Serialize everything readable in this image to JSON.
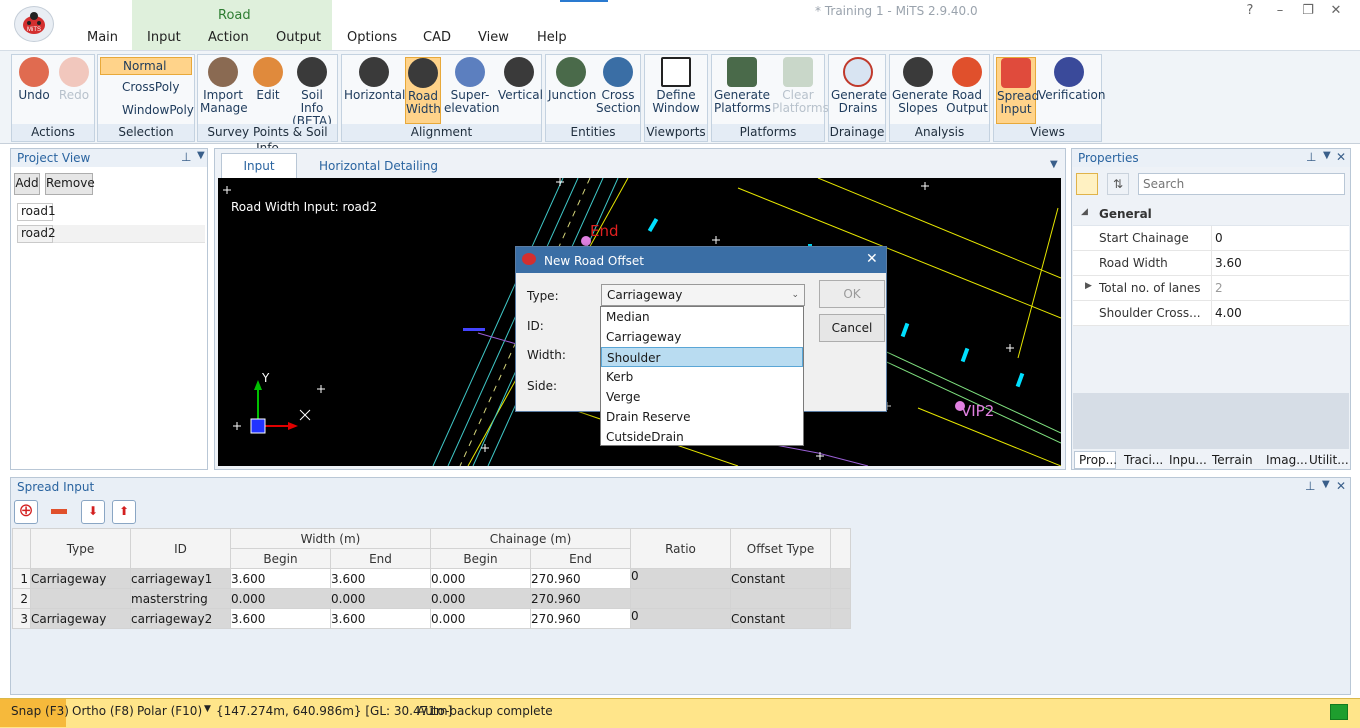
{
  "app": {
    "title": "* Training 1 - MiTS 2.9.40.0",
    "logo_text": "MiTS"
  },
  "window_controls": [
    "?",
    "–",
    "❐",
    "✕"
  ],
  "menu": {
    "tabs": [
      "Main",
      "Input",
      "Action",
      "Output",
      "Options",
      "CAD",
      "View",
      "Help"
    ],
    "road_group_label": "Road"
  },
  "ribbon": {
    "groups": [
      {
        "label": "Actions",
        "buttons": [
          "Undo",
          "Redo"
        ]
      },
      {
        "label": "Selection",
        "buttons": [
          "Normal",
          "CrossPoly",
          "WindowPoly"
        ]
      },
      {
        "label": "Survey Points & Soil Info",
        "buttons": [
          "Import Manage",
          "Edit",
          "Soil Info (BETA)"
        ]
      },
      {
        "label": "Alignment",
        "buttons": [
          "Horizontal",
          "Road Width",
          "Super-elevation",
          "Vertical"
        ]
      },
      {
        "label": "Entities",
        "buttons": [
          "Junction",
          "Cross Section"
        ]
      },
      {
        "label": "Viewports",
        "buttons": [
          "Define Window"
        ]
      },
      {
        "label": "Platforms",
        "buttons": [
          "Generate Platforms",
          "Clear Platforms"
        ]
      },
      {
        "label": "Drainage",
        "buttons": [
          "Generate Drains"
        ]
      },
      {
        "label": "Analysis",
        "buttons": [
          "Generate Slopes",
          "Road Output"
        ]
      },
      {
        "label": "Views",
        "buttons": [
          "Spread Input",
          "Verification"
        ]
      }
    ]
  },
  "project_view": {
    "title": "Project View",
    "add_label": "Add",
    "remove_label": "Remove",
    "items": [
      "road1",
      "road2"
    ]
  },
  "main_view": {
    "tabs": [
      "Input",
      "Horizontal Detailing"
    ],
    "canvas_label": "Road Width Input: road2",
    "canvas_annotations": [
      "End",
      "VIP2",
      "Y"
    ]
  },
  "dialog": {
    "title": "New Road Offset",
    "type_label": "Type:",
    "type_value": "Carriageway",
    "id_label": "ID:",
    "width_label": "Width:",
    "side_label": "Side:",
    "ok_label": "OK",
    "cancel_label": "Cancel",
    "options": [
      "Median",
      "Carriageway",
      "Shoulder",
      "Kerb",
      "Verge",
      "Drain Reserve",
      "CutsideDrain"
    ],
    "highlighted": "Shoulder"
  },
  "properties": {
    "title": "Properties",
    "search_placeholder": "Search",
    "section": "General",
    "rows": [
      {
        "name": "Start Chainage",
        "value": "0"
      },
      {
        "name": "Road Width",
        "value": "3.60"
      },
      {
        "name": "Total no. of lanes",
        "value": "2"
      },
      {
        "name": "Shoulder Cross...",
        "value": "4.00"
      }
    ],
    "bottom_tabs": [
      "Prop...",
      "Traci...",
      "Inpu...",
      "Terrain",
      "Imag...",
      "Utilit..."
    ]
  },
  "spread_input": {
    "title": "Spread Input",
    "headers": {
      "type": "Type",
      "id": "ID",
      "width": "Width (m)",
      "chainage": "Chainage (m)",
      "begin": "Begin",
      "end": "End",
      "ratio": "Ratio",
      "offset_type": "Offset Type"
    },
    "rows": [
      {
        "n": "1",
        "type": "Carriageway",
        "id": "carriageway1",
        "w_begin": "3.600",
        "w_end": "3.600",
        "c_begin": "0.000",
        "c_end": "270.960",
        "ratio": "0",
        "offset_type": "Constant"
      },
      {
        "n": "2",
        "type": "",
        "id": "masterstring",
        "w_begin": "0.000",
        "w_end": "0.000",
        "c_begin": "0.000",
        "c_end": "270.960",
        "ratio": "",
        "offset_type": ""
      },
      {
        "n": "3",
        "type": "Carriageway",
        "id": "carriageway2",
        "w_begin": "3.600",
        "w_end": "3.600",
        "c_begin": "0.000",
        "c_end": "270.960",
        "ratio": "0",
        "offset_type": "Constant"
      }
    ]
  },
  "status": {
    "snap": "Snap (F3)",
    "ortho": "Ortho (F8)",
    "polar": "Polar (F10)",
    "coords": "{147.274m, 640.986m} [GL: 30.471m]",
    "message": "Auto-backup complete"
  }
}
